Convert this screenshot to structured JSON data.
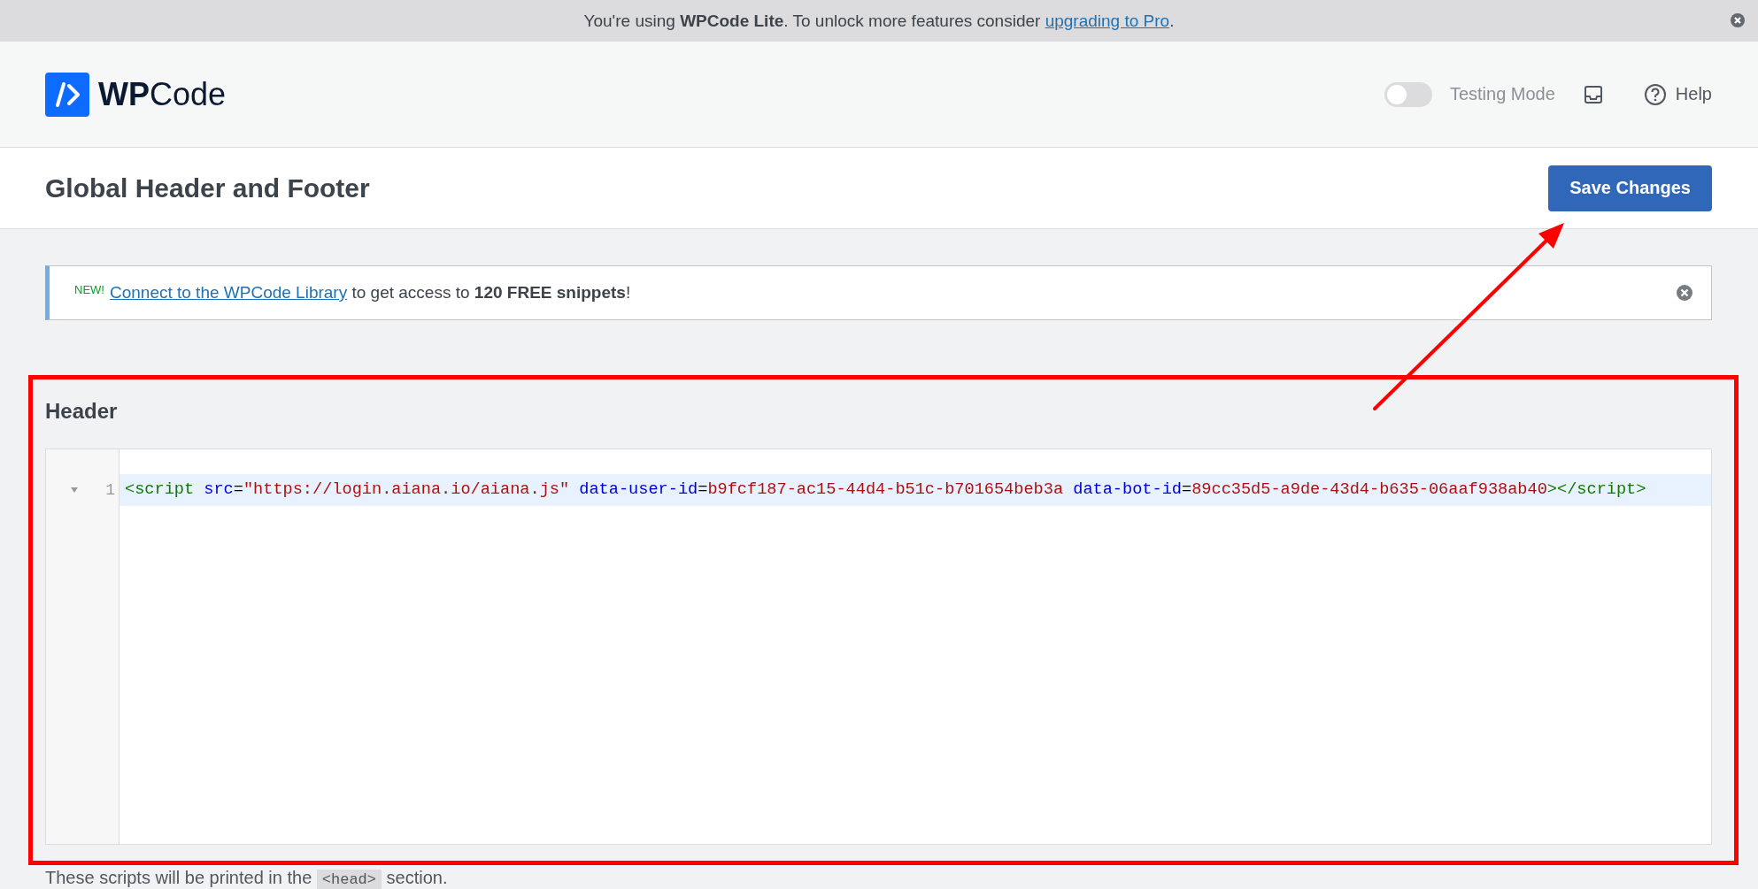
{
  "promo_bar": {
    "text": "You're using **WPCode Lite**. To unlock more features consider",
    "link": "upgrading to Pro",
    "end": "."
  },
  "header": {
    "logo_text_bold": "WP",
    "logo_text": "Code",
    "testing_mode": {
      "label": "Testing Mode",
      "on": false
    },
    "help": "Help"
  },
  "page": {
    "title": "Global Header and Footer",
    "save_button": "Save Changes"
  },
  "notice": {
    "badge": "NEW!",
    "link": "Connect to the WPCode Library",
    "text": " to get access to **120 FREE snippets**!"
  },
  "section": {
    "title": "Header",
    "code_lines": [
      {
        "number": "1",
        "active": true,
        "tokens": [
          {
            "text": "<script",
            "kind": "tag"
          },
          {
            "text": " src",
            "kind": "attr"
          },
          {
            "text": "=",
            "kind": "plain"
          },
          {
            "text": "\"https://login.aiana.io/aiana.js\"",
            "kind": "string"
          },
          {
            "text": " data-user-id",
            "kind": "attr"
          },
          {
            "text": "=",
            "kind": "plain"
          },
          {
            "text": "b9fcf187-ac15-44d4-b51c-b701654beb3a",
            "kind": "string"
          },
          {
            "text": " data-bot-id",
            "kind": "attr"
          },
          {
            "text": "=",
            "kind": "plain"
          },
          {
            "text": "89cc35d5-a9de-43d4-b635-06aaf938ab40",
            "kind": "string"
          },
          {
            "text": "></script>",
            "kind": "tag"
          }
        ]
      }
    ],
    "help_before": "These scripts will be printed in the",
    "help_code": "<head>",
    "help_after": "section."
  }
}
